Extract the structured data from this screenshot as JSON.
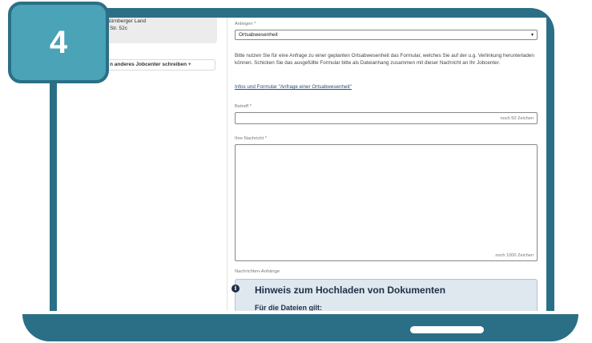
{
  "step_badge": {
    "number": "4"
  },
  "sidebar": {
    "address_line1": "Nürnberger Land",
    "address_line2": "r Str. 52c",
    "other_jobcenter_button": "n anderes Jobcenter schreiben +"
  },
  "form": {
    "anliegen_label": "Anliegen *",
    "anliegen_value": "Ortsabwesenheit",
    "anliegen_caret": "▾",
    "info_text": "Bitte nutzen Sie für eine Anfrage zu einer geplanten Ortsabwesenheit das Formular, welches Sie auf der u.g. Verlinkung herunterladen können. Schicken Sie das ausgefüllte Formular bitte als Dateianhang zusammen mit dieser Nachricht an Ihr Jobcenter.",
    "info_link": "Infos und Formular \"Anfrage einer Ortsabwesenheit\"",
    "betreff_label": "Betreff *",
    "betreff_counter": "noch 50 Zeichen",
    "nachricht_label": "Ihre Nachricht *",
    "nachricht_counter": "noch 1000 Zeichen",
    "anhaenge_label": "Nachrichten-Anhänge"
  },
  "notice": {
    "icon": "info-icon",
    "title": "Hinweis zum Hochladen von Dokumenten",
    "subtitle": "Für die Dateien gilt:"
  },
  "colors": {
    "laptop": "#2b6f86",
    "badge": "#4aa3b6",
    "notice_bg": "#dfe7ef"
  }
}
